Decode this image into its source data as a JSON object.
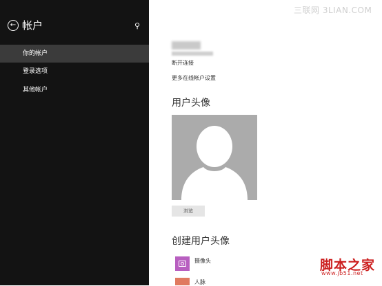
{
  "sidebar": {
    "title": "帐户",
    "items": [
      {
        "label": "你的帐户"
      },
      {
        "label": "登录选项"
      },
      {
        "label": "其他帐户"
      }
    ]
  },
  "account": {
    "name": "刘XX",
    "email": "xxxxxxxxx@live.cn",
    "disconnect": "断开连接",
    "more_settings": "更多在线帐户设置"
  },
  "picture": {
    "heading": "用户头像",
    "browse_label": "浏览"
  },
  "create": {
    "heading": "创建用户头像",
    "apps": [
      {
        "label": "摄像头",
        "color": "#b85fc0",
        "icon": "camera-icon"
      },
      {
        "label": "人脉",
        "color": "#e07a60",
        "icon": "people-icon"
      }
    ]
  },
  "watermark": "三联网 3LIAN.COM",
  "logo": {
    "text": "脚本之家",
    "url": "www.jb51.net"
  },
  "colors": {
    "sidebar_bg": "#131313",
    "active_item_bg": "#3b3b3b",
    "avatar_bg": "#ababab"
  }
}
